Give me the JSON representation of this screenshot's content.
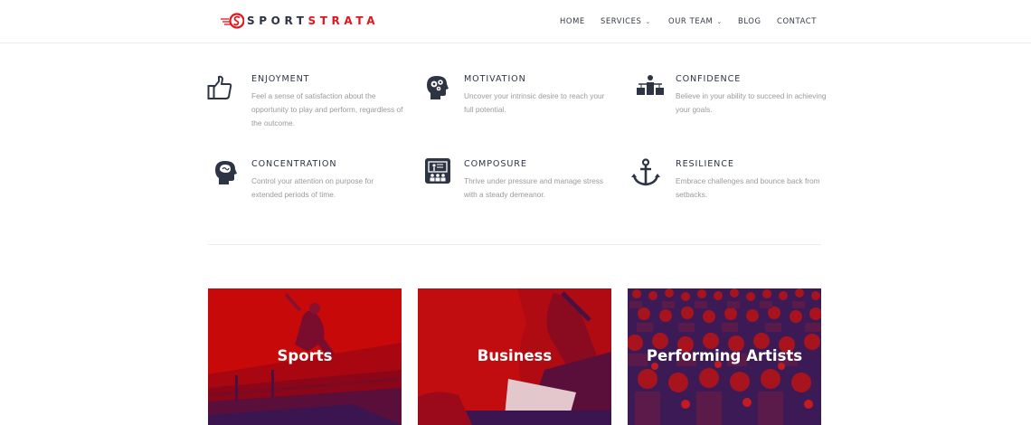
{
  "brand": {
    "part1": "SPORT",
    "part2": "STRATA",
    "accent_color": "#e3141b",
    "dark_color": "#2d3444"
  },
  "nav": {
    "items": [
      {
        "label": "HOME",
        "has_dropdown": false
      },
      {
        "label": "SERVICES",
        "has_dropdown": true
      },
      {
        "label": "OUR TEAM",
        "has_dropdown": true
      },
      {
        "label": "BLOG",
        "has_dropdown": false
      },
      {
        "label": "CONTACT",
        "has_dropdown": false
      }
    ]
  },
  "features": [
    {
      "title": "ENJOYMENT",
      "icon": "thumbs-up-icon",
      "description": "Feel a sense of satisfaction about the opportunity to play and perform, regardless of the outcome."
    },
    {
      "title": "MOTIVATION",
      "icon": "head-gears-icon",
      "description": "Uncover your intrinsic desire to reach your full potential."
    },
    {
      "title": "CONFIDENCE",
      "icon": "person-scales-icon",
      "description": "Believe in your ability to succeed in achieving your goals."
    },
    {
      "title": "CONCENTRATION",
      "icon": "head-brain-icon",
      "description": "Control your attention on purpose for extended periods of time."
    },
    {
      "title": "COMPOSURE",
      "icon": "presentation-icon",
      "description": "Thrive under pressure and manage stress with a steady demeanor."
    },
    {
      "title": "RESILIENCE",
      "icon": "anchor-icon",
      "description": "Embrace challenges and bounce back from setbacks."
    }
  ],
  "cards": [
    {
      "label": "Sports",
      "overlay_color": "#cc0a0a"
    },
    {
      "label": "Business",
      "overlay_color": "#c20d10"
    },
    {
      "label": "Performing Artists",
      "overlay_color": "#3a1a58"
    }
  ]
}
